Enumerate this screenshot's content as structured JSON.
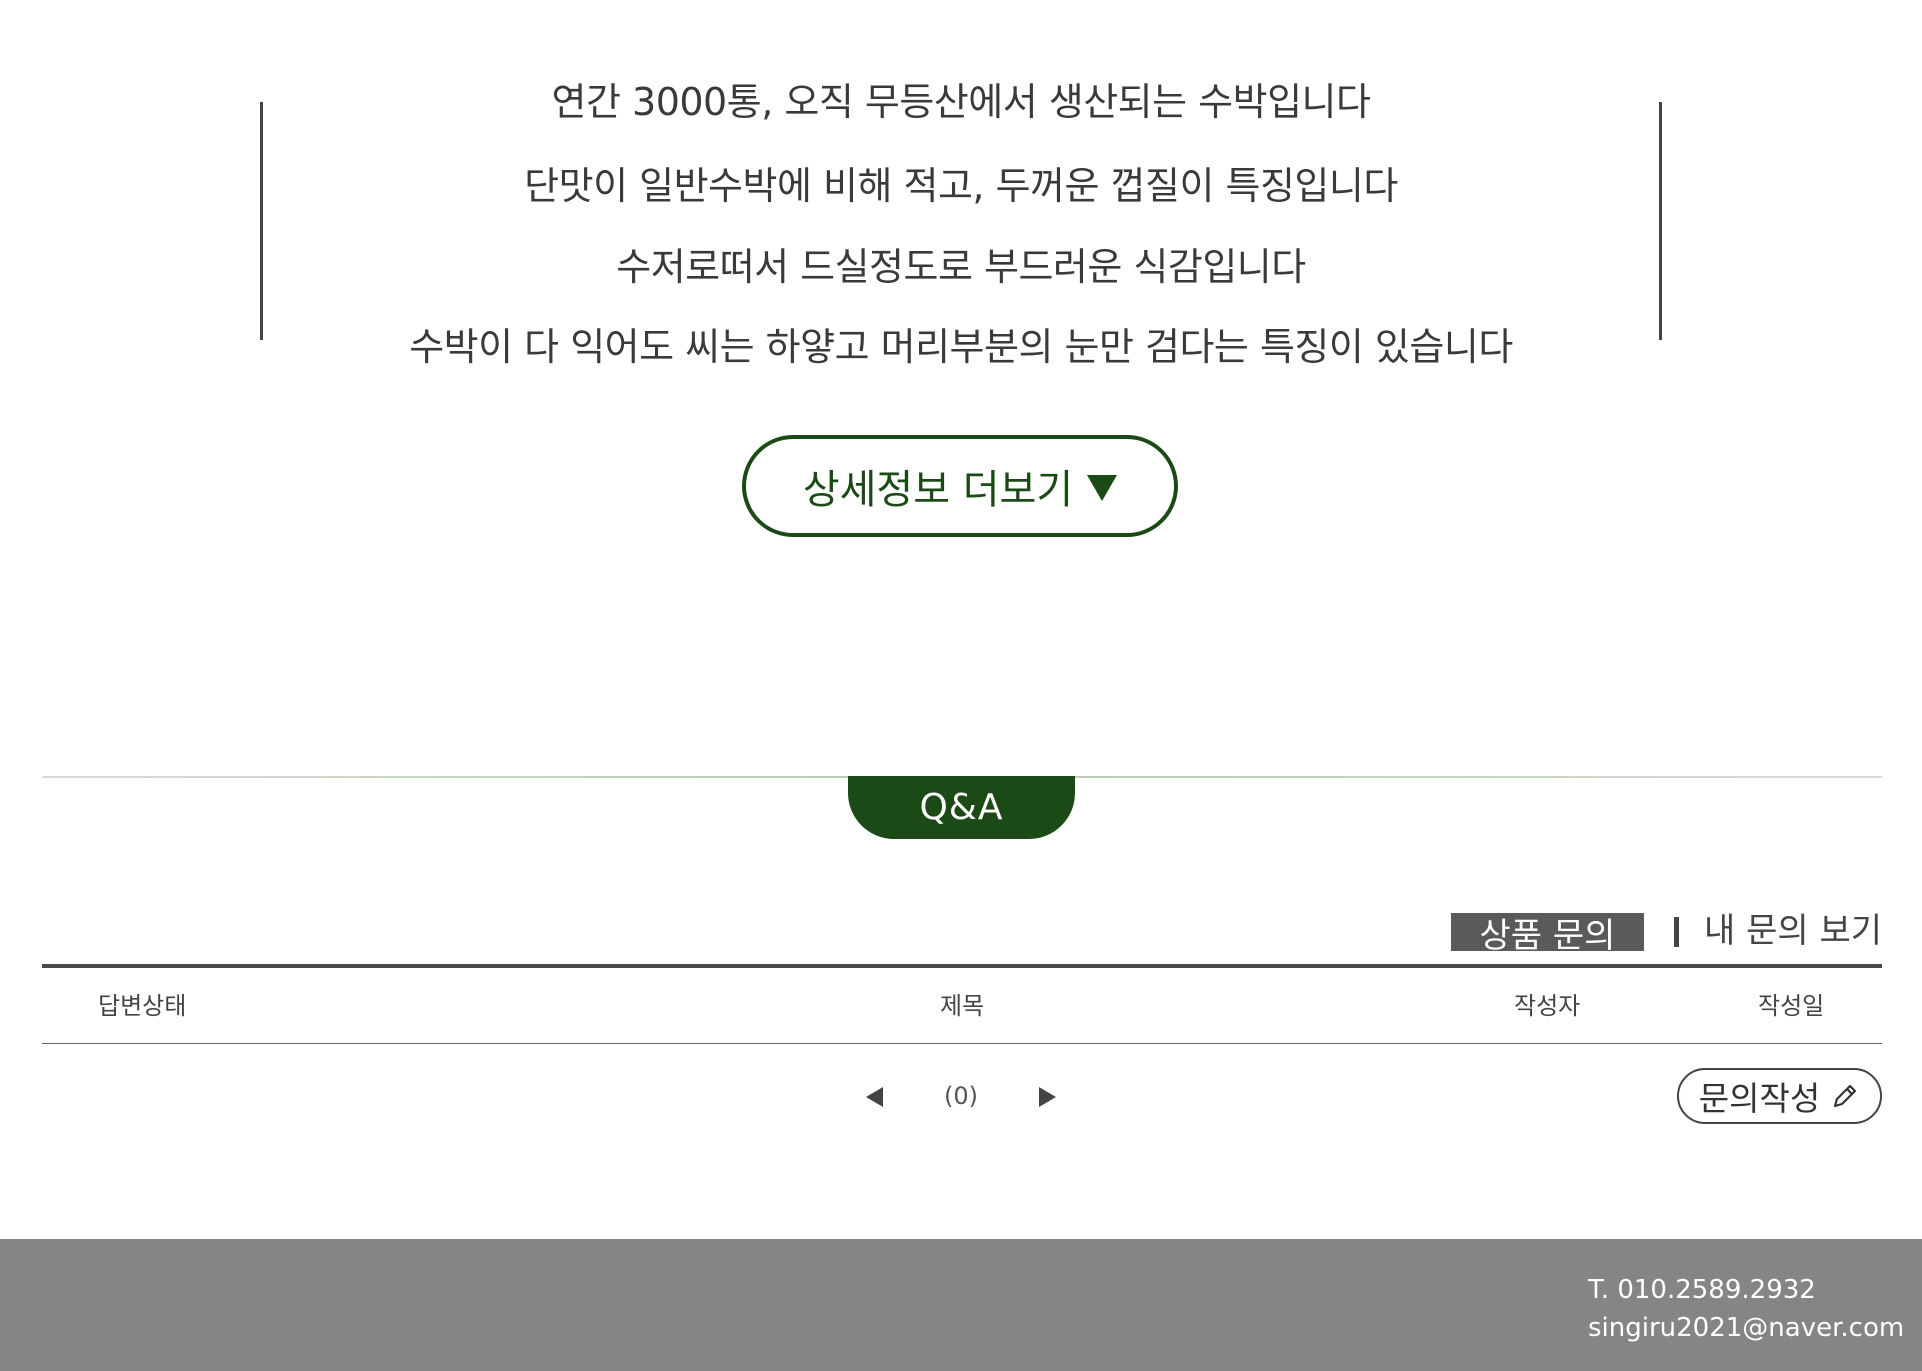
{
  "description": {
    "lines": [
      "연간 3000통, 오직 무등산에서 생산되는 수박입니다",
      "단맛이 일반수박에 비해 적고, 두꺼운 껍질이 특징입니다",
      "수저로떠서 드실정도로 부드러운 식감입니다",
      "수박이 다 익어도 씨는 하얗고 머리부분의 눈만 검다는 특징이 있습니다"
    ],
    "more_button_label": "상세정보 더보기"
  },
  "qa": {
    "title": "Q&A",
    "tabs": {
      "product_inquiry": "상품 문의",
      "my_inquiries": "내 문의 보기"
    },
    "table": {
      "headers": {
        "status": "답변상태",
        "title": "제목",
        "author": "작성자",
        "date": "작성일"
      },
      "rows": []
    },
    "pager": {
      "count": "(0)"
    },
    "write_button_label": "문의작성"
  },
  "footer": {
    "tel": "T. 010.2589.2932",
    "email": "singiru2021@naver.com"
  },
  "colors": {
    "brand_green": "#1c4a17",
    "tab_active_bg": "#5a5a5a",
    "footer_bg": "#858585"
  },
  "icons": {
    "more_button": "triangle-down-icon",
    "pager_prev": "triangle-left-icon",
    "pager_next": "triangle-right-icon",
    "write_button": "pencil-icon"
  }
}
